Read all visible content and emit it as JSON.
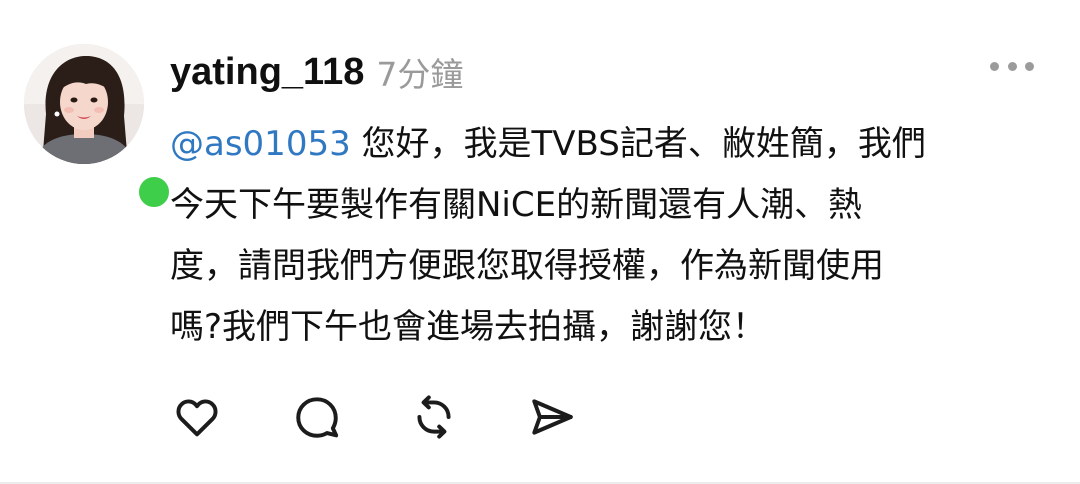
{
  "post": {
    "username": "yating_118",
    "timestamp": "7分鐘",
    "mention": "@as01053",
    "lines": [
      " 您好，我是TVBS記者、敝姓簡，我們",
      "今天下午要製作有關NiCE的新聞還有人潮、熱",
      "度，請問我們方便跟您取得授權，作為新聞使用",
      "嗎?我們下午也會進場去拍攝，謝謝您！"
    ]
  },
  "status": {
    "online": true,
    "online_color": "#3fce4a"
  },
  "colors": {
    "mention": "#3079c2",
    "meta_text": "#9a9a9a",
    "icon": "#1c1c1c"
  },
  "actions": {
    "items": [
      "heart-icon",
      "comment-icon",
      "repost-icon",
      "share-icon"
    ]
  },
  "menu": {
    "icon": "more-horizontal-icon"
  }
}
